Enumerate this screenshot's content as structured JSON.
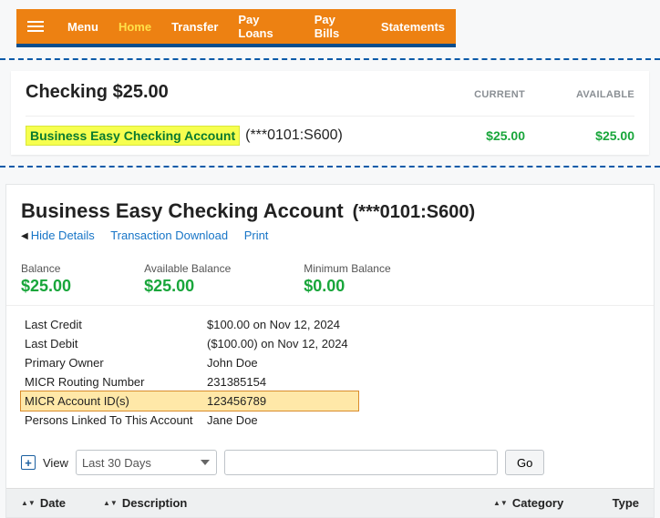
{
  "nav": {
    "menu_label": "Menu",
    "items": [
      "Home",
      "Transfer",
      "Pay Loans",
      "Pay Bills",
      "Statements"
    ],
    "active_index": 0
  },
  "summary": {
    "title": "Checking $25.00",
    "col_current": "CURRENT",
    "col_available": "AVAILABLE",
    "account_name": "Business Easy Checking Account",
    "account_mask": "(***0101:S600)",
    "current_amount": "$25.00",
    "available_amount": "$25.00"
  },
  "details": {
    "title": "Business Easy Checking Account",
    "mask": "(***0101:S600)",
    "actions": {
      "hide": "Hide Details",
      "download": "Transaction Download",
      "print": "Print"
    },
    "balances": {
      "balance_label": "Balance",
      "balance": "$25.00",
      "available_label": "Available Balance",
      "available": "$25.00",
      "minimum_label": "Minimum Balance",
      "minimum": "$0.00"
    },
    "info": [
      {
        "k": "Last Credit",
        "v": "$100.00 on Nov 12, 2024"
      },
      {
        "k": "Last Debit",
        "v": "($100.00) on Nov 12, 2024"
      },
      {
        "k": "Primary Owner",
        "v": "John Doe"
      },
      {
        "k": "MICR Routing Number",
        "v": "231385154"
      },
      {
        "k": "MICR Account ID(s)",
        "v": "123456789",
        "highlight": true
      },
      {
        "k": "Persons Linked To This Account",
        "v": "Jane Doe"
      }
    ]
  },
  "filter": {
    "view_label": "View",
    "range_selected": "Last 30 Days",
    "search_value": "",
    "go_label": "Go"
  },
  "tx_columns": {
    "date": "Date",
    "description": "Description",
    "category": "Category",
    "type": "Type"
  }
}
